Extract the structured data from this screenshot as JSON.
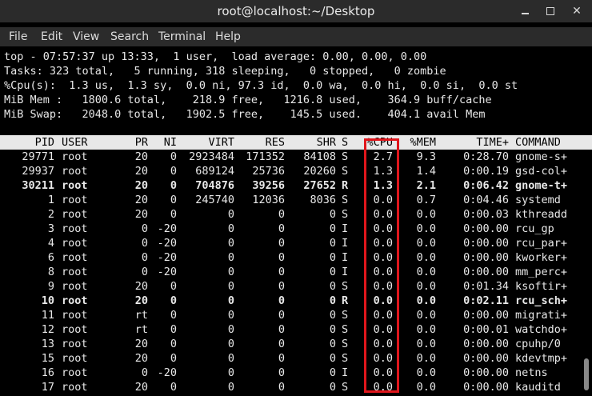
{
  "window": {
    "title": "root@localhost:~/Desktop",
    "minimize_glyph": "",
    "close_glyph": "✕"
  },
  "menubar": {
    "items": [
      "File",
      "Edit",
      "View",
      "Search",
      "Terminal",
      "Help"
    ]
  },
  "summary": {
    "line1": "top - 07:57:37 up 13:33,  1 user,  load average: 0.00, 0.00, 0.00",
    "line2": "Tasks: 323 total,   5 running, 318 sleeping,   0 stopped,   0 zombie",
    "line3": "%Cpu(s):  1.3 us,  1.3 sy,  0.0 ni, 97.3 id,  0.0 wa,  0.0 hi,  0.0 si,  0.0 st",
    "line4": "MiB Mem :   1800.6 total,    218.9 free,   1216.8 used,    364.9 buff/cache",
    "line5": "MiB Swap:   2048.0 total,   1902.5 free,    145.5 used.    404.1 avail Mem"
  },
  "table": {
    "headers": [
      "PID",
      "USER",
      "PR",
      "NI",
      "VIRT",
      "RES",
      "SHR",
      "S",
      "%CPU",
      "%MEM",
      "TIME+",
      "COMMAND"
    ],
    "rows": [
      {
        "pid": "29771",
        "user": "root",
        "pr": "20",
        "ni": "0",
        "virt": "2923484",
        "res": "171352",
        "shr": "84108",
        "s": "S",
        "cpu": "2.7",
        "mem": "9.3",
        "time": "0:28.70",
        "cmd": "gnome-s+",
        "bold": false
      },
      {
        "pid": "29937",
        "user": "root",
        "pr": "20",
        "ni": "0",
        "virt": "689124",
        "res": "25736",
        "shr": "20260",
        "s": "S",
        "cpu": "1.3",
        "mem": "1.4",
        "time": "0:00.19",
        "cmd": "gsd-col+",
        "bold": false
      },
      {
        "pid": "30211",
        "user": "root",
        "pr": "20",
        "ni": "0",
        "virt": "704876",
        "res": "39256",
        "shr": "27652",
        "s": "R",
        "cpu": "1.3",
        "mem": "2.1",
        "time": "0:06.42",
        "cmd": "gnome-t+",
        "bold": true
      },
      {
        "pid": "1",
        "user": "root",
        "pr": "20",
        "ni": "0",
        "virt": "245740",
        "res": "12036",
        "shr": "8036",
        "s": "S",
        "cpu": "0.0",
        "mem": "0.7",
        "time": "0:04.46",
        "cmd": "systemd",
        "bold": false
      },
      {
        "pid": "2",
        "user": "root",
        "pr": "20",
        "ni": "0",
        "virt": "0",
        "res": "0",
        "shr": "0",
        "s": "S",
        "cpu": "0.0",
        "mem": "0.0",
        "time": "0:00.03",
        "cmd": "kthreadd",
        "bold": false
      },
      {
        "pid": "3",
        "user": "root",
        "pr": "0",
        "ni": "-20",
        "virt": "0",
        "res": "0",
        "shr": "0",
        "s": "I",
        "cpu": "0.0",
        "mem": "0.0",
        "time": "0:00.00",
        "cmd": "rcu_gp",
        "bold": false
      },
      {
        "pid": "4",
        "user": "root",
        "pr": "0",
        "ni": "-20",
        "virt": "0",
        "res": "0",
        "shr": "0",
        "s": "I",
        "cpu": "0.0",
        "mem": "0.0",
        "time": "0:00.00",
        "cmd": "rcu_par+",
        "bold": false
      },
      {
        "pid": "6",
        "user": "root",
        "pr": "0",
        "ni": "-20",
        "virt": "0",
        "res": "0",
        "shr": "0",
        "s": "I",
        "cpu": "0.0",
        "mem": "0.0",
        "time": "0:00.00",
        "cmd": "kworker+",
        "bold": false
      },
      {
        "pid": "8",
        "user": "root",
        "pr": "0",
        "ni": "-20",
        "virt": "0",
        "res": "0",
        "shr": "0",
        "s": "I",
        "cpu": "0.0",
        "mem": "0.0",
        "time": "0:00.00",
        "cmd": "mm_perc+",
        "bold": false
      },
      {
        "pid": "9",
        "user": "root",
        "pr": "20",
        "ni": "0",
        "virt": "0",
        "res": "0",
        "shr": "0",
        "s": "S",
        "cpu": "0.0",
        "mem": "0.0",
        "time": "0:01.34",
        "cmd": "ksoftir+",
        "bold": false
      },
      {
        "pid": "10",
        "user": "root",
        "pr": "20",
        "ni": "0",
        "virt": "0",
        "res": "0",
        "shr": "0",
        "s": "R",
        "cpu": "0.0",
        "mem": "0.0",
        "time": "0:02.11",
        "cmd": "rcu_sch+",
        "bold": true
      },
      {
        "pid": "11",
        "user": "root",
        "pr": "rt",
        "ni": "0",
        "virt": "0",
        "res": "0",
        "shr": "0",
        "s": "S",
        "cpu": "0.0",
        "mem": "0.0",
        "time": "0:00.00",
        "cmd": "migrati+",
        "bold": false
      },
      {
        "pid": "12",
        "user": "root",
        "pr": "rt",
        "ni": "0",
        "virt": "0",
        "res": "0",
        "shr": "0",
        "s": "S",
        "cpu": "0.0",
        "mem": "0.0",
        "time": "0:00.01",
        "cmd": "watchdo+",
        "bold": false
      },
      {
        "pid": "13",
        "user": "root",
        "pr": "20",
        "ni": "0",
        "virt": "0",
        "res": "0",
        "shr": "0",
        "s": "S",
        "cpu": "0.0",
        "mem": "0.0",
        "time": "0:00.00",
        "cmd": "cpuhp/0",
        "bold": false
      },
      {
        "pid": "15",
        "user": "root",
        "pr": "20",
        "ni": "0",
        "virt": "0",
        "res": "0",
        "shr": "0",
        "s": "S",
        "cpu": "0.0",
        "mem": "0.0",
        "time": "0:00.00",
        "cmd": "kdevtmp+",
        "bold": false
      },
      {
        "pid": "16",
        "user": "root",
        "pr": "0",
        "ni": "-20",
        "virt": "0",
        "res": "0",
        "shr": "0",
        "s": "I",
        "cpu": "0.0",
        "mem": "0.0",
        "time": "0:00.00",
        "cmd": "netns",
        "bold": false
      },
      {
        "pid": "17",
        "user": "root",
        "pr": "20",
        "ni": "0",
        "virt": "0",
        "res": "0",
        "shr": "0",
        "s": "S",
        "cpu": "0.0",
        "mem": "0.0",
        "time": "0:00.00",
        "cmd": "kauditd",
        "bold": false
      }
    ]
  },
  "colors": {
    "highlight_box": "#e0161c",
    "header_bg": "#e8e8e8",
    "titlebar_bg": "#2b2b2b"
  }
}
